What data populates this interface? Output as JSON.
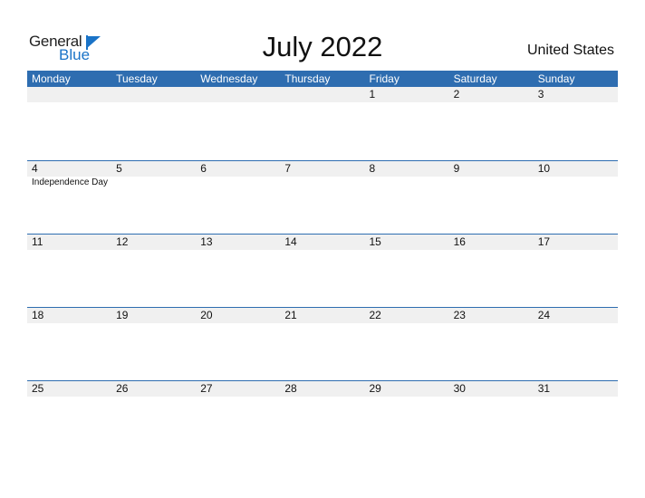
{
  "logo": {
    "word1": "General",
    "word2": "Blue"
  },
  "title": "July 2022",
  "country": "United States",
  "weekdays": [
    "Monday",
    "Tuesday",
    "Wednesday",
    "Thursday",
    "Friday",
    "Saturday",
    "Sunday"
  ],
  "weeks": [
    {
      "days": [
        "",
        "",
        "",
        "",
        "1",
        "2",
        "3"
      ],
      "events": [
        "",
        "",
        "",
        "",
        "",
        "",
        ""
      ]
    },
    {
      "days": [
        "4",
        "5",
        "6",
        "7",
        "8",
        "9",
        "10"
      ],
      "events": [
        "Independence Day",
        "",
        "",
        "",
        "",
        "",
        ""
      ]
    },
    {
      "days": [
        "11",
        "12",
        "13",
        "14",
        "15",
        "16",
        "17"
      ],
      "events": [
        "",
        "",
        "",
        "",
        "",
        "",
        ""
      ]
    },
    {
      "days": [
        "18",
        "19",
        "20",
        "21",
        "22",
        "23",
        "24"
      ],
      "events": [
        "",
        "",
        "",
        "",
        "",
        "",
        ""
      ]
    },
    {
      "days": [
        "25",
        "26",
        "27",
        "28",
        "29",
        "30",
        "31"
      ],
      "events": [
        "",
        "",
        "",
        "",
        "",
        "",
        ""
      ]
    }
  ],
  "colors": {
    "accent": "#2e6db0",
    "strip": "#f0f0f0",
    "logo_blue": "#1a73c7"
  }
}
